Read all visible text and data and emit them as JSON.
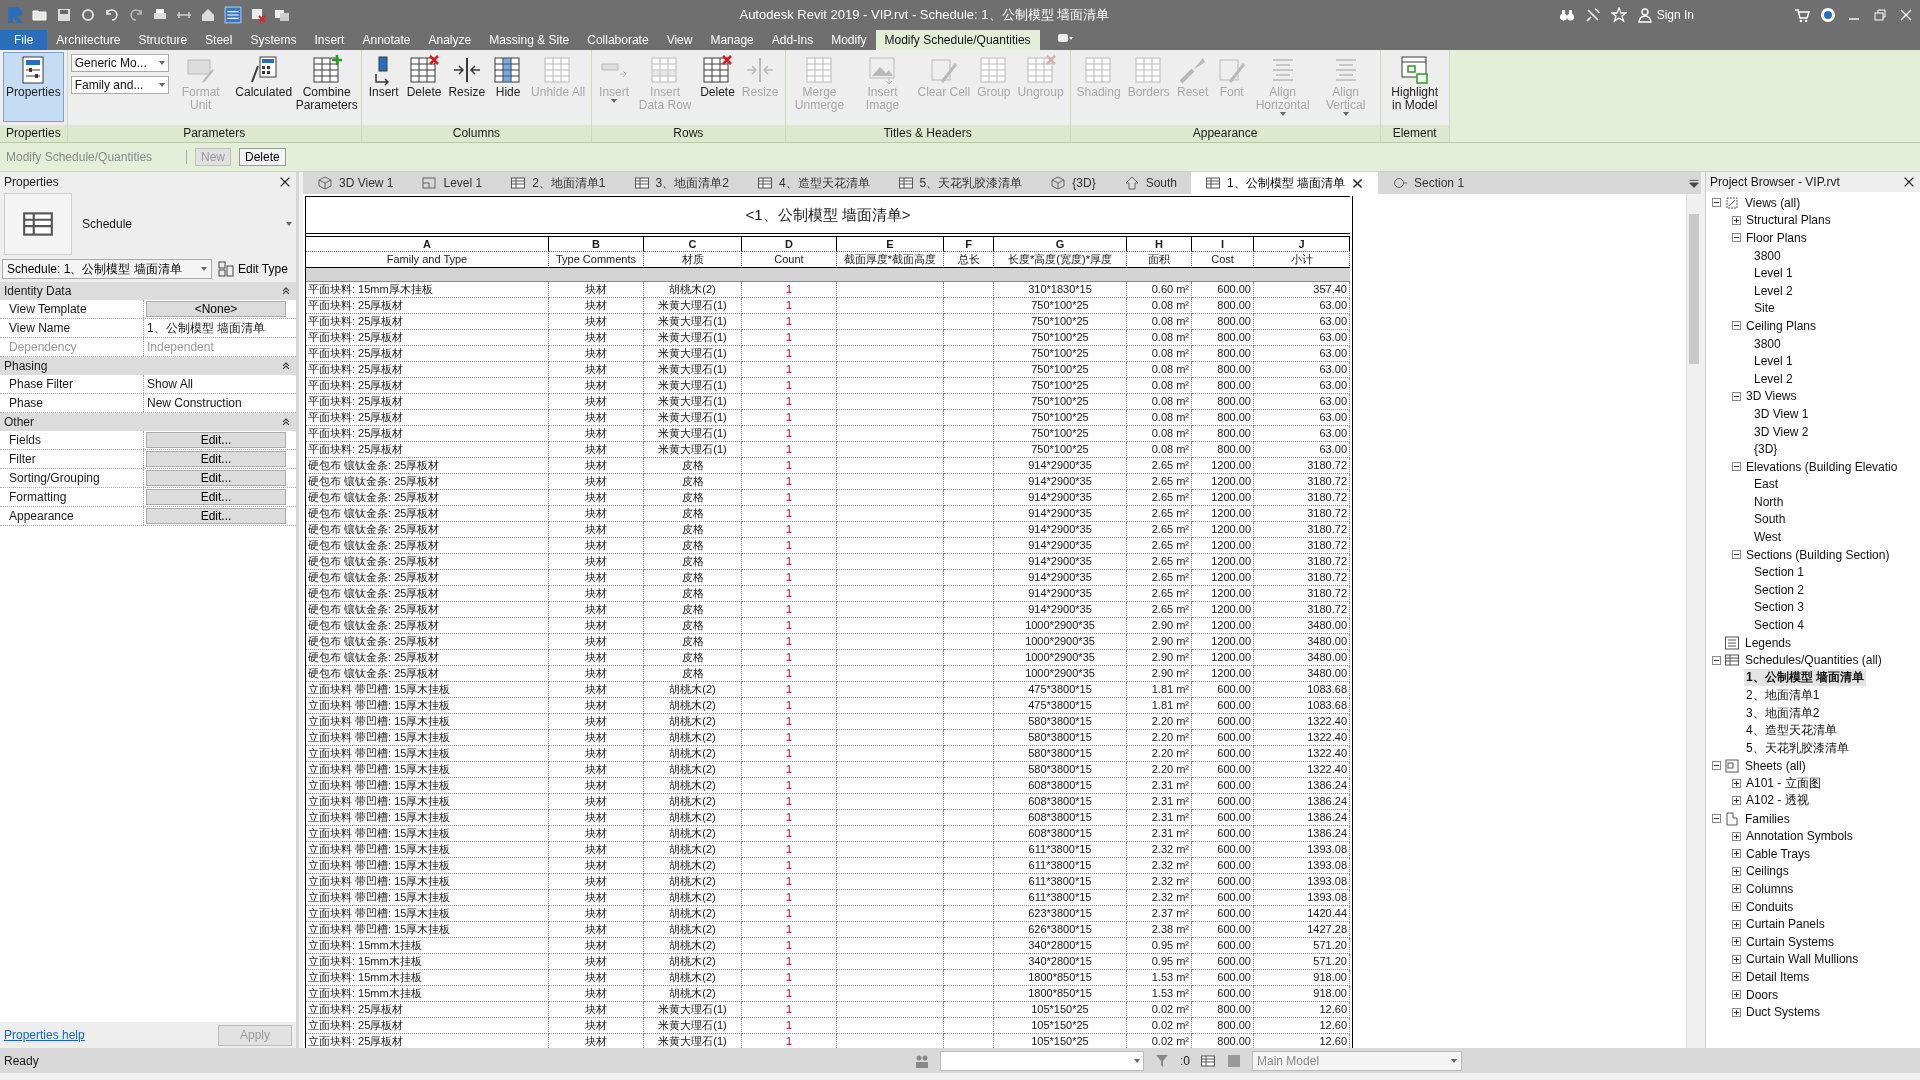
{
  "window": {
    "title": "Autodesk Revit 2019 - VIP.rvt - Schedule: 1、公制模型 墙面清单"
  },
  "title_bar": {
    "sign_in": "Sign In"
  },
  "ribbon": {
    "tabs": [
      {
        "label": "File",
        "kind": "application",
        "selected": false
      },
      {
        "label": "Architecture",
        "kind": "tab",
        "selected": false
      },
      {
        "label": "Structure",
        "kind": "tab",
        "selected": false
      },
      {
        "label": "Steel",
        "kind": "tab",
        "selected": false
      },
      {
        "label": "Systems",
        "kind": "tab",
        "selected": false
      },
      {
        "label": "Insert",
        "kind": "tab",
        "selected": false
      },
      {
        "label": "Annotate",
        "kind": "tab",
        "selected": false
      },
      {
        "label": "Analyze",
        "kind": "tab",
        "selected": false
      },
      {
        "label": "Massing & Site",
        "kind": "tab",
        "selected": false
      },
      {
        "label": "Collaborate",
        "kind": "tab",
        "selected": false
      },
      {
        "label": "View",
        "kind": "tab",
        "selected": false
      },
      {
        "label": "Manage",
        "kind": "tab",
        "selected": false
      },
      {
        "label": "Add-Ins",
        "kind": "tab",
        "selected": false
      },
      {
        "label": "Modify",
        "kind": "tab",
        "selected": false
      },
      {
        "label": "Modify Schedule/Quantities",
        "kind": "contextual",
        "selected": true
      }
    ],
    "panels": [
      {
        "label": "Properties",
        "tools": [
          {
            "label": "Properties",
            "kind": "large",
            "disabled": false,
            "pressed": true
          }
        ]
      },
      {
        "label": "Parameters",
        "tools": [
          {
            "label": "Generic Mo...",
            "kind": "combo",
            "disabled": false
          },
          {
            "label": "Family and...",
            "kind": "combo",
            "disabled": false
          },
          {
            "label": "Format Unit",
            "kind": "large",
            "disabled": true
          },
          {
            "label": "Calculated",
            "kind": "large",
            "disabled": false
          },
          {
            "label": "Combine Parameters",
            "kind": "large",
            "disabled": false
          }
        ]
      },
      {
        "label": "Columns",
        "tools": [
          {
            "label": "Insert",
            "kind": "large",
            "disabled": false
          },
          {
            "label": "Delete",
            "kind": "large",
            "disabled": false
          },
          {
            "label": "Resize",
            "kind": "large",
            "disabled": false
          },
          {
            "label": "Hide",
            "kind": "large",
            "disabled": false
          },
          {
            "label": "Unhide All",
            "kind": "large",
            "disabled": true
          }
        ]
      },
      {
        "label": "Rows",
        "tools": [
          {
            "label": "Insert",
            "kind": "split",
            "disabled": true
          },
          {
            "label": "Insert Data Row",
            "kind": "large",
            "disabled": true
          },
          {
            "label": "Delete",
            "kind": "large",
            "disabled": false
          },
          {
            "label": "Resize",
            "kind": "large",
            "disabled": true
          }
        ]
      },
      {
        "label": "Titles & Headers",
        "tools": [
          {
            "label": "Merge Unmerge",
            "kind": "large",
            "disabled": true
          },
          {
            "label": "Insert Image",
            "kind": "large",
            "disabled": true
          },
          {
            "label": "Clear Cell",
            "kind": "large",
            "disabled": true
          },
          {
            "label": "Group",
            "kind": "large",
            "disabled": true
          },
          {
            "label": "Ungroup",
            "kind": "large",
            "disabled": true
          }
        ]
      },
      {
        "label": "Appearance",
        "tools": [
          {
            "label": "Shading",
            "kind": "large",
            "disabled": true
          },
          {
            "label": "Borders",
            "kind": "large",
            "disabled": true
          },
          {
            "label": "Reset",
            "kind": "large",
            "disabled": true
          },
          {
            "label": "Font",
            "kind": "large",
            "disabled": true
          },
          {
            "label": "Align Horizontal",
            "kind": "split",
            "disabled": true
          },
          {
            "label": "Align Vertical",
            "kind": "split",
            "disabled": true
          }
        ]
      },
      {
        "label": "Element",
        "tools": [
          {
            "label": "Highlight in Model",
            "kind": "large",
            "disabled": false
          }
        ]
      }
    ]
  },
  "options_bar": {
    "context": "Modify Schedule/Quantities",
    "buttons": [
      {
        "label": "New",
        "disabled": true
      },
      {
        "label": "Delete",
        "disabled": false
      }
    ]
  },
  "properties": {
    "title": "Properties",
    "type_name": "Schedule",
    "instance": "Schedule: 1、公制模型 墙面清单",
    "edit_type": "Edit Type",
    "groups": [
      {
        "name": "Identity Data",
        "expanded": true,
        "rows": [
          {
            "label": "View Template",
            "value": "<None>",
            "kind": "button",
            "disabled": false
          },
          {
            "label": "View Name",
            "value": "1、公制模型 墙面清单",
            "kind": "text",
            "disabled": false
          },
          {
            "label": "Dependency",
            "value": "Independent",
            "kind": "text",
            "disabled": true
          }
        ]
      },
      {
        "name": "Phasing",
        "expanded": true,
        "rows": [
          {
            "label": "Phase Filter",
            "value": "Show All",
            "kind": "text",
            "disabled": false
          },
          {
            "label": "Phase",
            "value": "New Construction",
            "kind": "text",
            "disabled": false
          }
        ]
      },
      {
        "name": "Other",
        "expanded": true,
        "rows": [
          {
            "label": "Fields",
            "value": "Edit...",
            "kind": "button",
            "disabled": false
          },
          {
            "label": "Filter",
            "value": "Edit...",
            "kind": "button",
            "disabled": false
          },
          {
            "label": "Sorting/Grouping",
            "value": "Edit...",
            "kind": "button",
            "disabled": false
          },
          {
            "label": "Formatting",
            "value": "Edit...",
            "kind": "button",
            "disabled": false
          },
          {
            "label": "Appearance",
            "value": "Edit...",
            "kind": "button",
            "disabled": false
          }
        ]
      }
    ],
    "help": "Properties help",
    "apply": {
      "label": "Apply",
      "disabled": true
    }
  },
  "view_tabs": [
    {
      "label": "3D View 1",
      "kind": "model",
      "selected": false
    },
    {
      "label": "Level 1",
      "kind": "plan",
      "selected": false
    },
    {
      "label": "2、地面清单1",
      "kind": "schedule",
      "selected": false
    },
    {
      "label": "3、地面清单2",
      "kind": "schedule",
      "selected": false
    },
    {
      "label": "4、造型天花清单",
      "kind": "schedule",
      "selected": false
    },
    {
      "label": "5、天花乳胶漆清单",
      "kind": "schedule",
      "selected": false
    },
    {
      "label": "{3D}",
      "kind": "model",
      "selected": false
    },
    {
      "label": "South",
      "kind": "elevation",
      "selected": false
    },
    {
      "label": "1、公制模型 墙面清单",
      "kind": "schedule",
      "selected": true
    },
    {
      "label": "Section 1",
      "kind": "section",
      "selected": false
    }
  ],
  "schedule": {
    "title": "<1、公制模型 墙面清单>",
    "columns": [
      {
        "letter": "A",
        "heading": "Family and Type"
      },
      {
        "letter": "B",
        "heading": "Type Comments"
      },
      {
        "letter": "C",
        "heading": "材质"
      },
      {
        "letter": "D",
        "heading": "Count"
      },
      {
        "letter": "E",
        "heading": "截面厚度*截面高度"
      },
      {
        "letter": "F",
        "heading": "总长"
      },
      {
        "letter": "G",
        "heading": "长度*高度(宽度)*厚度"
      },
      {
        "letter": "H",
        "heading": "面积"
      },
      {
        "letter": "I",
        "heading": "Cost"
      },
      {
        "letter": "J",
        "heading": "小计"
      }
    ],
    "rows": [
      [
        "平面块料: 15mm厚木挂板",
        "块材",
        "胡桃木(2)",
        "1",
        "",
        "",
        "310*1830*15",
        "0.60 m²",
        "600.00",
        "357.40"
      ],
      [
        "平面块料: 25厚板材",
        "块材",
        "米黄大理石(1)",
        "1",
        "",
        "",
        "750*100*25",
        "0.08 m²",
        "800.00",
        "63.00"
      ],
      [
        "平面块料: 25厚板材",
        "块材",
        "米黄大理石(1)",
        "1",
        "",
        "",
        "750*100*25",
        "0.08 m²",
        "800.00",
        "63.00"
      ],
      [
        "平面块料: 25厚板材",
        "块材",
        "米黄大理石(1)",
        "1",
        "",
        "",
        "750*100*25",
        "0.08 m²",
        "800.00",
        "63.00"
      ],
      [
        "平面块料: 25厚板材",
        "块材",
        "米黄大理石(1)",
        "1",
        "",
        "",
        "750*100*25",
        "0.08 m²",
        "800.00",
        "63.00"
      ],
      [
        "平面块料: 25厚板材",
        "块材",
        "米黄大理石(1)",
        "1",
        "",
        "",
        "750*100*25",
        "0.08 m²",
        "800.00",
        "63.00"
      ],
      [
        "平面块料: 25厚板材",
        "块材",
        "米黄大理石(1)",
        "1",
        "",
        "",
        "750*100*25",
        "0.08 m²",
        "800.00",
        "63.00"
      ],
      [
        "平面块料: 25厚板材",
        "块材",
        "米黄大理石(1)",
        "1",
        "",
        "",
        "750*100*25",
        "0.08 m²",
        "800.00",
        "63.00"
      ],
      [
        "平面块料: 25厚板材",
        "块材",
        "米黄大理石(1)",
        "1",
        "",
        "",
        "750*100*25",
        "0.08 m²",
        "800.00",
        "63.00"
      ],
      [
        "平面块料: 25厚板材",
        "块材",
        "米黄大理石(1)",
        "1",
        "",
        "",
        "750*100*25",
        "0.08 m²",
        "800.00",
        "63.00"
      ],
      [
        "平面块料: 25厚板材",
        "块材",
        "米黄大理石(1)",
        "1",
        "",
        "",
        "750*100*25",
        "0.08 m²",
        "800.00",
        "63.00"
      ],
      [
        "硬包布 镶钛金条: 25厚板材",
        "块材",
        "皮格",
        "1",
        "",
        "",
        "914*2900*35",
        "2.65 m²",
        "1200.00",
        "3180.72"
      ],
      [
        "硬包布 镶钛金条: 25厚板材",
        "块材",
        "皮格",
        "1",
        "",
        "",
        "914*2900*35",
        "2.65 m²",
        "1200.00",
        "3180.72"
      ],
      [
        "硬包布 镶钛金条: 25厚板材",
        "块材",
        "皮格",
        "1",
        "",
        "",
        "914*2900*35",
        "2.65 m²",
        "1200.00",
        "3180.72"
      ],
      [
        "硬包布 镶钛金条: 25厚板材",
        "块材",
        "皮格",
        "1",
        "",
        "",
        "914*2900*35",
        "2.65 m²",
        "1200.00",
        "3180.72"
      ],
      [
        "硬包布 镶钛金条: 25厚板材",
        "块材",
        "皮格",
        "1",
        "",
        "",
        "914*2900*35",
        "2.65 m²",
        "1200.00",
        "3180.72"
      ],
      [
        "硬包布 镶钛金条: 25厚板材",
        "块材",
        "皮格",
        "1",
        "",
        "",
        "914*2900*35",
        "2.65 m²",
        "1200.00",
        "3180.72"
      ],
      [
        "硬包布 镶钛金条: 25厚板材",
        "块材",
        "皮格",
        "1",
        "",
        "",
        "914*2900*35",
        "2.65 m²",
        "1200.00",
        "3180.72"
      ],
      [
        "硬包布 镶钛金条: 25厚板材",
        "块材",
        "皮格",
        "1",
        "",
        "",
        "914*2900*35",
        "2.65 m²",
        "1200.00",
        "3180.72"
      ],
      [
        "硬包布 镶钛金条: 25厚板材",
        "块材",
        "皮格",
        "1",
        "",
        "",
        "914*2900*35",
        "2.65 m²",
        "1200.00",
        "3180.72"
      ],
      [
        "硬包布 镶钛金条: 25厚板材",
        "块材",
        "皮格",
        "1",
        "",
        "",
        "914*2900*35",
        "2.65 m²",
        "1200.00",
        "3180.72"
      ],
      [
        "硬包布 镶钛金条: 25厚板材",
        "块材",
        "皮格",
        "1",
        "",
        "",
        "1000*2900*35",
        "2.90 m²",
        "1200.00",
        "3480.00"
      ],
      [
        "硬包布 镶钛金条: 25厚板材",
        "块材",
        "皮格",
        "1",
        "",
        "",
        "1000*2900*35",
        "2.90 m²",
        "1200.00",
        "3480.00"
      ],
      [
        "硬包布 镶钛金条: 25厚板材",
        "块材",
        "皮格",
        "1",
        "",
        "",
        "1000*2900*35",
        "2.90 m²",
        "1200.00",
        "3480.00"
      ],
      [
        "硬包布 镶钛金条: 25厚板材",
        "块材",
        "皮格",
        "1",
        "",
        "",
        "1000*2900*35",
        "2.90 m²",
        "1200.00",
        "3480.00"
      ],
      [
        "立面块料 带凹槽: 15厚木挂板",
        "块材",
        "胡桃木(2)",
        "1",
        "",
        "",
        "475*3800*15",
        "1.81 m²",
        "600.00",
        "1083.68"
      ],
      [
        "立面块料 带凹槽: 15厚木挂板",
        "块材",
        "胡桃木(2)",
        "1",
        "",
        "",
        "475*3800*15",
        "1.81 m²",
        "600.00",
        "1083.68"
      ],
      [
        "立面块料 带凹槽: 15厚木挂板",
        "块材",
        "胡桃木(2)",
        "1",
        "",
        "",
        "580*3800*15",
        "2.20 m²",
        "600.00",
        "1322.40"
      ],
      [
        "立面块料 带凹槽: 15厚木挂板",
        "块材",
        "胡桃木(2)",
        "1",
        "",
        "",
        "580*3800*15",
        "2.20 m²",
        "600.00",
        "1322.40"
      ],
      [
        "立面块料 带凹槽: 15厚木挂板",
        "块材",
        "胡桃木(2)",
        "1",
        "",
        "",
        "580*3800*15",
        "2.20 m²",
        "600.00",
        "1322.40"
      ],
      [
        "立面块料 带凹槽: 15厚木挂板",
        "块材",
        "胡桃木(2)",
        "1",
        "",
        "",
        "580*3800*15",
        "2.20 m²",
        "600.00",
        "1322.40"
      ],
      [
        "立面块料 带凹槽: 15厚木挂板",
        "块材",
        "胡桃木(2)",
        "1",
        "",
        "",
        "608*3800*15",
        "2.31 m²",
        "600.00",
        "1386.24"
      ],
      [
        "立面块料 带凹槽: 15厚木挂板",
        "块材",
        "胡桃木(2)",
        "1",
        "",
        "",
        "608*3800*15",
        "2.31 m²",
        "600.00",
        "1386.24"
      ],
      [
        "立面块料 带凹槽: 15厚木挂板",
        "块材",
        "胡桃木(2)",
        "1",
        "",
        "",
        "608*3800*15",
        "2.31 m²",
        "600.00",
        "1386.24"
      ],
      [
        "立面块料 带凹槽: 15厚木挂板",
        "块材",
        "胡桃木(2)",
        "1",
        "",
        "",
        "608*3800*15",
        "2.31 m²",
        "600.00",
        "1386.24"
      ],
      [
        "立面块料 带凹槽: 15厚木挂板",
        "块材",
        "胡桃木(2)",
        "1",
        "",
        "",
        "611*3800*15",
        "2.32 m²",
        "600.00",
        "1393.08"
      ],
      [
        "立面块料 带凹槽: 15厚木挂板",
        "块材",
        "胡桃木(2)",
        "1",
        "",
        "",
        "611*3800*15",
        "2.32 m²",
        "600.00",
        "1393.08"
      ],
      [
        "立面块料 带凹槽: 15厚木挂板",
        "块材",
        "胡桃木(2)",
        "1",
        "",
        "",
        "611*3800*15",
        "2.32 m²",
        "600.00",
        "1393.08"
      ],
      [
        "立面块料 带凹槽: 15厚木挂板",
        "块材",
        "胡桃木(2)",
        "1",
        "",
        "",
        "611*3800*15",
        "2.32 m²",
        "600.00",
        "1393.08"
      ],
      [
        "立面块料 带凹槽: 15厚木挂板",
        "块材",
        "胡桃木(2)",
        "1",
        "",
        "",
        "623*3800*15",
        "2.37 m²",
        "600.00",
        "1420.44"
      ],
      [
        "立面块料 带凹槽: 15厚木挂板",
        "块材",
        "胡桃木(2)",
        "1",
        "",
        "",
        "626*3800*15",
        "2.38 m²",
        "600.00",
        "1427.28"
      ],
      [
        "立面块料: 15mm木挂板",
        "块材",
        "胡桃木(2)",
        "1",
        "",
        "",
        "340*2800*15",
        "0.95 m²",
        "600.00",
        "571.20"
      ],
      [
        "立面块料: 15mm木挂板",
        "块材",
        "胡桃木(2)",
        "1",
        "",
        "",
        "340*2800*15",
        "0.95 m²",
        "600.00",
        "571.20"
      ],
      [
        "立面块料: 15mm木挂板",
        "块材",
        "胡桃木(2)",
        "1",
        "",
        "",
        "1800*850*15",
        "1.53 m²",
        "600.00",
        "918.00"
      ],
      [
        "立面块料: 15mm木挂板",
        "块材",
        "胡桃木(2)",
        "1",
        "",
        "",
        "1800*850*15",
        "1.53 m²",
        "600.00",
        "918.00"
      ],
      [
        "立面块料: 25厚板材",
        "块材",
        "米黄大理石(1)",
        "1",
        "",
        "",
        "105*150*25",
        "0.02 m²",
        "800.00",
        "12.60"
      ],
      [
        "立面块料: 25厚板材",
        "块材",
        "米黄大理石(1)",
        "1",
        "",
        "",
        "105*150*25",
        "0.02 m²",
        "800.00",
        "12.60"
      ],
      [
        "立面块料: 25厚板材",
        "块材",
        "米黄大理石(1)",
        "1",
        "",
        "",
        "105*150*25",
        "0.02 m²",
        "800.00",
        "12.60"
      ]
    ]
  },
  "project_browser": {
    "title": "Project Browser - VIP.rvt",
    "tree": [
      {
        "label": "Views (all)",
        "kind": "views",
        "expanded": true,
        "children": [
          {
            "label": "Structural Plans",
            "expanded": false
          },
          {
            "label": "Floor Plans",
            "expanded": true,
            "children": [
              {
                "label": "3800"
              },
              {
                "label": "Level 1"
              },
              {
                "label": "Level 2"
              },
              {
                "label": "Site"
              }
            ]
          },
          {
            "label": "Ceiling Plans",
            "expanded": true,
            "children": [
              {
                "label": "3800"
              },
              {
                "label": "Level 1"
              },
              {
                "label": "Level 2"
              }
            ]
          },
          {
            "label": "3D Views",
            "expanded": true,
            "children": [
              {
                "label": "3D View 1"
              },
              {
                "label": "3D View 2"
              },
              {
                "label": "{3D}"
              }
            ]
          },
          {
            "label": "Elevations (Building Elevatio",
            "expanded": true,
            "children": [
              {
                "label": "East"
              },
              {
                "label": "North"
              },
              {
                "label": "South"
              },
              {
                "label": "West"
              }
            ]
          },
          {
            "label": "Sections (Building Section)",
            "expanded": true,
            "children": [
              {
                "label": "Section 1"
              },
              {
                "label": "Section 2"
              },
              {
                "label": "Section 3"
              },
              {
                "label": "Section 4"
              }
            ]
          }
        ]
      },
      {
        "label": "Legends",
        "kind": "legends"
      },
      {
        "label": "Schedules/Quantities (all)",
        "kind": "schedules",
        "expanded": true,
        "children": [
          {
            "label": "1、公制模型 墙面清单",
            "selected": true
          },
          {
            "label": "2、地面清单1",
            "selected": false
          },
          {
            "label": "3、地面清单2",
            "selected": false
          },
          {
            "label": "4、造型天花清单",
            "selected": false
          },
          {
            "label": "5、天花乳胶漆清单",
            "selected": false
          }
        ]
      },
      {
        "label": "Sheets (all)",
        "kind": "sheets",
        "expanded": true,
        "children": [
          {
            "label": "A101 - 立面图",
            "expanded": false
          },
          {
            "label": "A102 - 透视",
            "expanded": false
          }
        ]
      },
      {
        "label": "Families",
        "kind": "families",
        "expanded": true,
        "children": [
          {
            "label": "Annotation Symbols",
            "expanded": false
          },
          {
            "label": "Cable Trays",
            "expanded": false
          },
          {
            "label": "Ceilings",
            "expanded": false
          },
          {
            "label": "Columns",
            "expanded": false
          },
          {
            "label": "Conduits",
            "expanded": false
          },
          {
            "label": "Curtain Panels",
            "expanded": false
          },
          {
            "label": "Curtain Systems",
            "expanded": false
          },
          {
            "label": "Curtain Wall Mullions",
            "expanded": false
          },
          {
            "label": "Detail Items",
            "expanded": false
          },
          {
            "label": "Doors",
            "expanded": false
          },
          {
            "label": "Duct Systems",
            "expanded": false
          }
        ]
      }
    ]
  },
  "status_bar": {
    "text": "Ready",
    "filter_count": ":0",
    "model": "Main Model"
  }
}
